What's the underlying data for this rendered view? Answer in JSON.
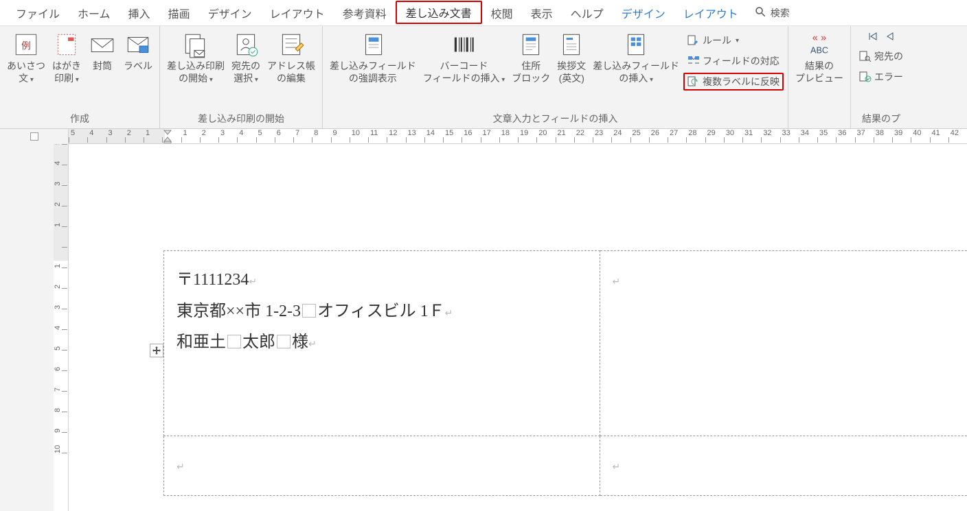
{
  "tabs": {
    "file": "ファイル",
    "home": "ホーム",
    "insert": "挿入",
    "draw": "描画",
    "design": "デザイン",
    "layout": "レイアウト",
    "references": "参考資料",
    "mailings": "差し込み文書",
    "review": "校閲",
    "view": "表示",
    "help": "ヘルプ",
    "ctx_design": "デザイン",
    "ctx_layout": "レイアウト",
    "search": "検索"
  },
  "ribbon": {
    "create": {
      "greeting": "あいさつ\n文",
      "postcard": "はがき\n印刷",
      "envelope": "封筒",
      "label": "ラベル",
      "group": "作成"
    },
    "start": {
      "start_merge": "差し込み印刷\nの開始",
      "select_recipients": "宛先の\n選択",
      "edit_recipients": "アドレス帳\nの編集",
      "group": "差し込み印刷の開始"
    },
    "write": {
      "highlight": "差し込みフィールド\nの強調表示",
      "barcode": "バーコード\nフィールドの挿入",
      "address_block": "住所\nブロック",
      "greeting_line": "挨拶文\n(英文)",
      "insert_field": "差し込みフィールド\nの挿入",
      "rules": "ルール",
      "match_fields": "フィールドの対応",
      "update_labels": "複数ラベルに反映",
      "group": "文章入力とフィールドの挿入"
    },
    "preview": {
      "preview_results": "結果の\nプレビュー",
      "find_recipient": "宛先の",
      "error_check": "エラー",
      "group": "結果のプ"
    }
  },
  "document": {
    "line1_postal_mark": "〒",
    "line1_postal": "1111234",
    "line2_addr_a": "東京都××市 1-2-3",
    "line2_addr_b": "オフィスビル 1Ｆ",
    "line3_name_a": "和亜土",
    "line3_name_b": "太郎",
    "line3_name_c": "様"
  }
}
